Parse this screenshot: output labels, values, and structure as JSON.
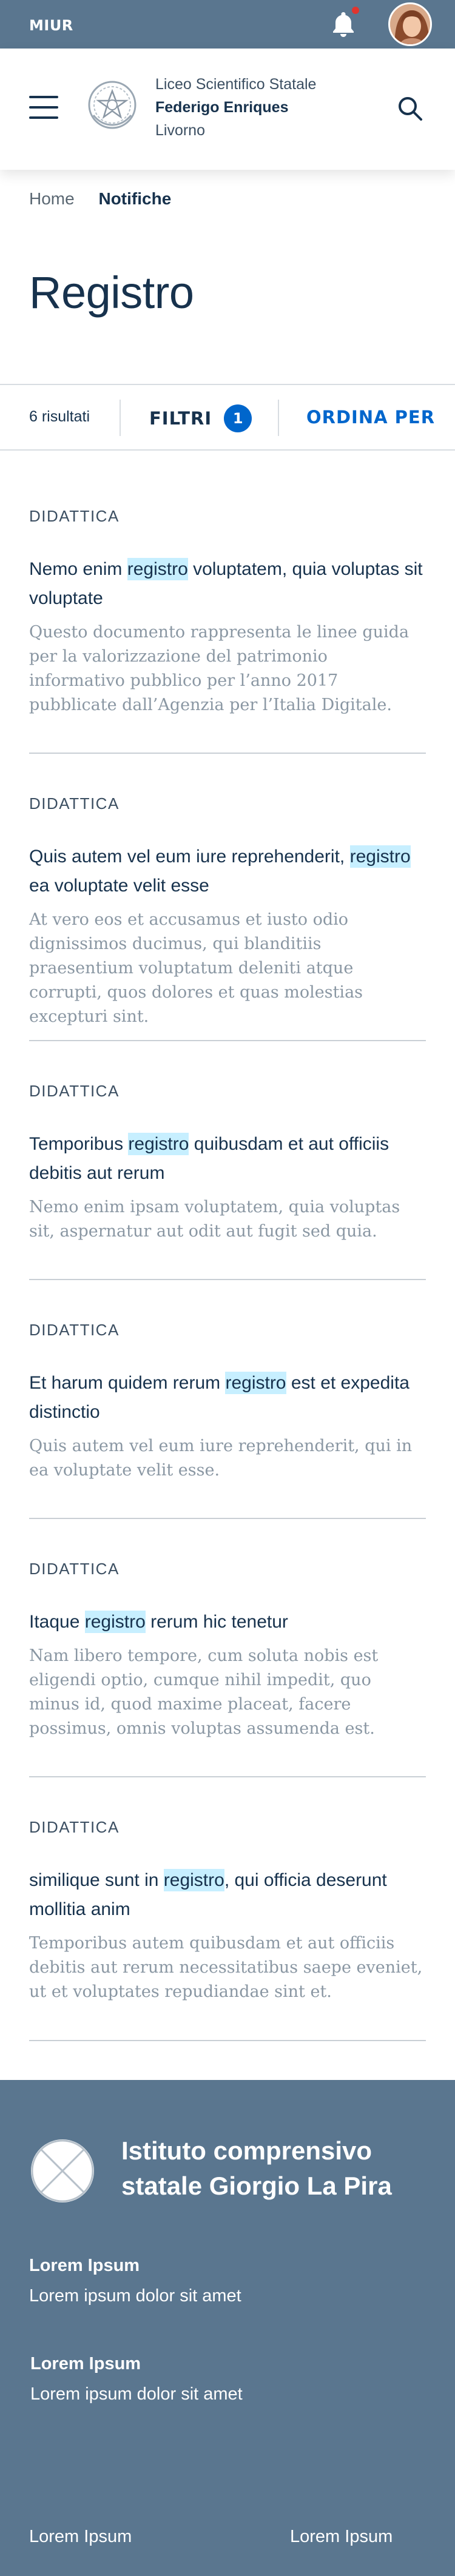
{
  "topbar": {
    "brand": "MIUR",
    "notification_icon": "bell-icon",
    "avatar_icon": "user-avatar"
  },
  "header": {
    "menu_icon": "hamburger-icon",
    "emblem_icon": "italian-republic-emblem",
    "school_line1": "Liceo Scientifico Statale",
    "school_line2": "Federigo Enriques",
    "school_line3": "Livorno",
    "search_icon": "search-icon"
  },
  "breadcrumb": {
    "home": "Home",
    "current": "Notifiche"
  },
  "page": {
    "title": "Registro"
  },
  "results_bar": {
    "count": "6 risultati",
    "filter_label": "FILTRI",
    "filter_badge": "1",
    "order_label": "ORDINA PER"
  },
  "results": [
    {
      "category": "DIDATTICA",
      "title_before": "Nemo enim ",
      "title_highlight": "registro",
      "title_after": " voluptatem, quia voluptas sit voluptate",
      "description": "Questo documento rappresenta le linee guida per la valorizzazione del patrimonio informativo pubblico per l’anno 2017 pubblicate dall’Agenzia per l’Italia Digitale."
    },
    {
      "category": "DIDATTICA",
      "title_before": "Quis autem vel eum iure reprehenderit, ",
      "title_highlight": "registro",
      "title_after": " ea voluptate velit esse",
      "description": "At vero eos et accusamus et iusto odio dignissimos ducimus, qui blanditiis praesentium voluptatum deleniti atque corrupti, quos dolores et quas molestias excepturi sint."
    },
    {
      "category": "DIDATTICA",
      "title_before": "Temporibus ",
      "title_highlight": "registro",
      "title_after": " quibusdam et aut officiis debitis aut rerum",
      "description": "Nemo enim ipsam voluptatem, quia voluptas sit, aspernatur aut odit aut fugit sed quia."
    },
    {
      "category": "DIDATTICA",
      "title_before": "Et harum quidem rerum ",
      "title_highlight": "registro",
      "title_after": " est et expedita distinctio",
      "description": "Quis autem vel eum iure reprehenderit, qui in ea voluptate velit esse."
    },
    {
      "category": "DIDATTICA",
      "title_before": "Itaque ",
      "title_highlight": "registro",
      "title_after": " rerum hic tenetur",
      "description": "Nam libero tempore, cum soluta nobis est eligendi optio, cumque nihil impedit, quo minus id, quod maxime placeat, facere possimus, omnis voluptas assumenda est."
    },
    {
      "category": "DIDATTICA",
      "title_before": "similique sunt in ",
      "title_highlight": "registro",
      "title_after": ", qui officia deserunt mollitia anim",
      "description": "Temporibus autem quibusdam et aut officiis debitis aut rerum necessitatibus saepe eveniet, ut et voluptates repudiandae sint et."
    }
  ],
  "footer": {
    "logo_icon": "placeholder-logo",
    "title": "Istituto comprensivo statale Giorgio La Pira",
    "block1_title": "Lorem Ipsum",
    "block1_text": "Lorem ipsum dolor sit amet",
    "block2_title": "Lorem Ipsum",
    "block2_text": "Lorem ipsum dolor sit amet",
    "link_left": "Lorem Ipsum",
    "link_right": "Lorem Ipsum"
  },
  "colors": {
    "primary_dark": "#17324d",
    "accent_blue": "#0066cc",
    "highlight": "#c7efff",
    "topbar_bg": "#5a768f",
    "notification_dot": "#e1352e"
  }
}
